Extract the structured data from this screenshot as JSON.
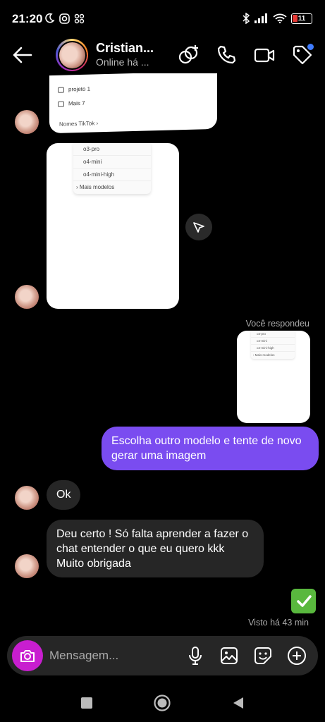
{
  "status_bar": {
    "time": "21:20",
    "battery": "11"
  },
  "header": {
    "name": "Cristian...",
    "status": "Online há ..."
  },
  "chat": {
    "card1": {
      "row1": "projeto 1",
      "row2": "Mais 7",
      "footer": "Nomes TikTok ›"
    },
    "card2": {
      "items": [
        "o3-pro",
        "o4-mini",
        "o4-mini-high",
        "› Mais modelos"
      ]
    },
    "card3": {
      "items": [
        "o3-pro",
        "o4-mini",
        "o4-mini-high",
        "› Mais modelos"
      ]
    },
    "replied_label": "Você respondeu",
    "outgoing_message": "Escolha outro modelo e tente de novo gerar uma imagem",
    "incoming_ok": "Ok",
    "incoming_long": "Deu certo ! Só falta aprender a fazer o chat entender o que eu quero kkk Muito obrigada",
    "seen_label": "Visto há 43 min"
  },
  "composer": {
    "placeholder": "Mensagem..."
  },
  "icons": {
    "status_left": [
      "moon-icon",
      "instagram-icon",
      "apps-icon"
    ],
    "status_right": [
      "bluetooth-icon",
      "signal-icon",
      "wifi-icon",
      "battery-icon"
    ],
    "header": [
      "back-arrow-icon",
      "add-person-icon",
      "phone-icon",
      "video-icon",
      "tag-icon"
    ],
    "composer": [
      "camera-icon",
      "mic-icon",
      "gallery-icon",
      "sticker-icon",
      "plus-icon"
    ],
    "nav": [
      "square-icon",
      "circle-icon",
      "triangle-back-icon"
    ]
  },
  "colors": {
    "accent": "#7a4cf0",
    "camera": "#c81ecf",
    "bubble_in": "#262626",
    "badge": "#3f7cff"
  }
}
